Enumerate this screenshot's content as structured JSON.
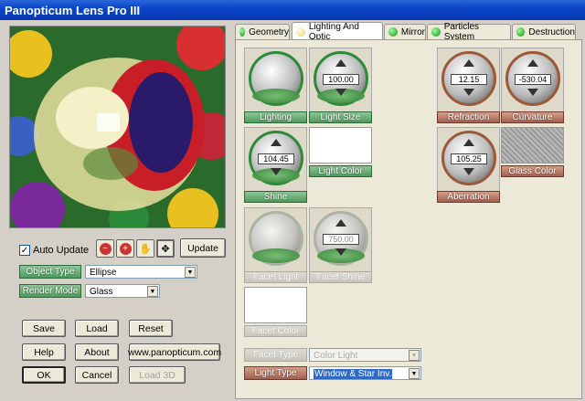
{
  "window": {
    "title": "Panopticum Lens Pro III"
  },
  "left": {
    "auto_update_label": "Auto Update",
    "auto_update_checked": true,
    "update_label": "Update",
    "tool_icons": [
      "zoom-out-icon",
      "zoom-in-icon",
      "hand-icon",
      "move-icon"
    ],
    "object_type_label": "Object Type",
    "object_type_value": "Ellipse",
    "render_mode_label": "Render Mode",
    "render_mode_value": "Glass",
    "buttons": {
      "save": "Save",
      "load": "Load",
      "reset": "Reset",
      "help": "Help",
      "about": "About",
      "website": "www.panopticum.com",
      "ok": "OK",
      "cancel": "Cancel",
      "load3d": "Load 3D"
    }
  },
  "tabs": [
    {
      "label": "Geometry"
    },
    {
      "label": "Lighting And Optic"
    },
    {
      "label": "Mirror"
    },
    {
      "label": "Particles System"
    },
    {
      "label": "Destruction"
    }
  ],
  "panel": {
    "lighting": "Lighting",
    "light_size": {
      "label": "Light Size",
      "value": "100.00"
    },
    "shine": {
      "label": "Shine",
      "value": "104.45"
    },
    "light_color": "Light Color",
    "facet_light": "Facet Light",
    "facet_shine": {
      "label": "Facet Shine",
      "value": "750.00"
    },
    "facet_color": "Facet Color",
    "refraction": {
      "label": "Refraction",
      "value": "12.15"
    },
    "curvature": {
      "label": "Curvature",
      "value": "-530.04"
    },
    "aberration": {
      "label": "Aberration",
      "value": "105.25"
    },
    "glass_color": "Glass Color",
    "facet_type_label": "Facet Type",
    "facet_type_value": "Color Light",
    "light_type_label": "Light Type",
    "light_type_value": "Window & Star Inv."
  }
}
